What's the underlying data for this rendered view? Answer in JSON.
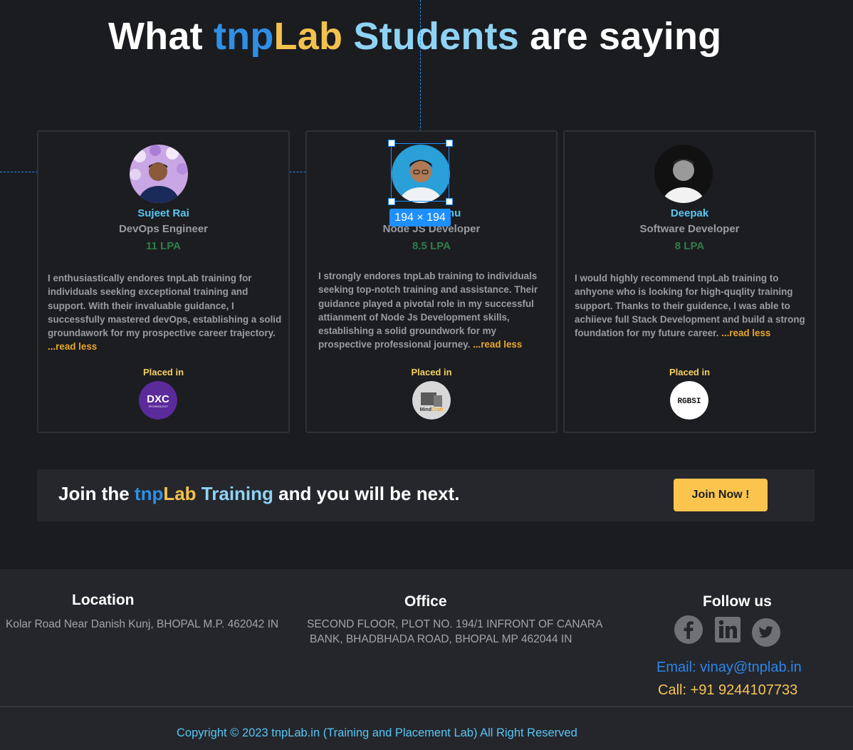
{
  "heading": {
    "what": "What",
    "tnp": "tnp",
    "lab": "Lab",
    "students": "Students",
    "rest": "are saying"
  },
  "testimonials": [
    {
      "name": "Sujeet Rai",
      "role": "DevOps Engineer",
      "package": "11 LPA",
      "review": "I enthusiastically endores tnpLab training for individuals seeking exceptional training and support. With their invaluable guidance, I successfully mastered devOps, establishing a solid groundawork for my prospective career trajectory.",
      "read_less": "...read less",
      "placed_label": "Placed in",
      "company_logo": "DXC TECHNOLOGY"
    },
    {
      "name": "Sumit Sahu",
      "role": "Node JS Developer",
      "package": "8.5 LPA",
      "review": "I strongly endores tnpLab training to individuals seeking top-notch training and assistance. Their guidance played a pivotal role in my successful attianment of Node Js Development skills, establishing a solid groundwork for my prospective professional journey.",
      "read_less": "...read less",
      "placed_label": "Placed in",
      "company_logo": "MindCraft"
    },
    {
      "name": "Deepak",
      "role": "Software Developer",
      "package": "8 LPA",
      "review": "I would highly recommend tnpLab training to anhyone  who is looking for high-quqlity training support. Thanks to their guidence, I was able to achiieve full Stack Development  and build a strong foundation for  my future career.",
      "read_less": "...read less",
      "placed_label": "Placed in",
      "company_logo": "RGBSI"
    }
  ],
  "selection_badge": "194 × 194",
  "join": {
    "prefix": "Join the",
    "tnp": "tnp",
    "lab": "Lab",
    "training": "Training",
    "suffix": "and you will be next.",
    "button": "Join Now !"
  },
  "footer": {
    "location_title": "Location",
    "location_text": "Kolar Road Near Danish Kunj, BHOPAL M.P. 462042 IN",
    "office_title": "Office",
    "office_line1": "SECOND FLOOR, PLOT NO. 194/1 INFRONT OF CANARA",
    "office_line2": "BANK, BHADBHADA ROAD, BHOPAL MP 462044 IN",
    "follow_title": "Follow us",
    "social_icons": [
      "facebook-icon",
      "linkedin-icon",
      "twitter-icon"
    ],
    "email": "Email: vinay@tnplab.in",
    "call": "Call: +91 9244107733",
    "copyright": "Copyright © 2023 tnpLab.in (Training and Placement Lab) All Right Reserved"
  },
  "colors": {
    "background": "#1b1c20",
    "brand_blue": "#2f8fe6",
    "brand_yellow": "#f3c14d",
    "accent_light_blue": "#8fd3f4",
    "package_green": "#2f7d4a",
    "selection_blue": "#1e8fff"
  }
}
